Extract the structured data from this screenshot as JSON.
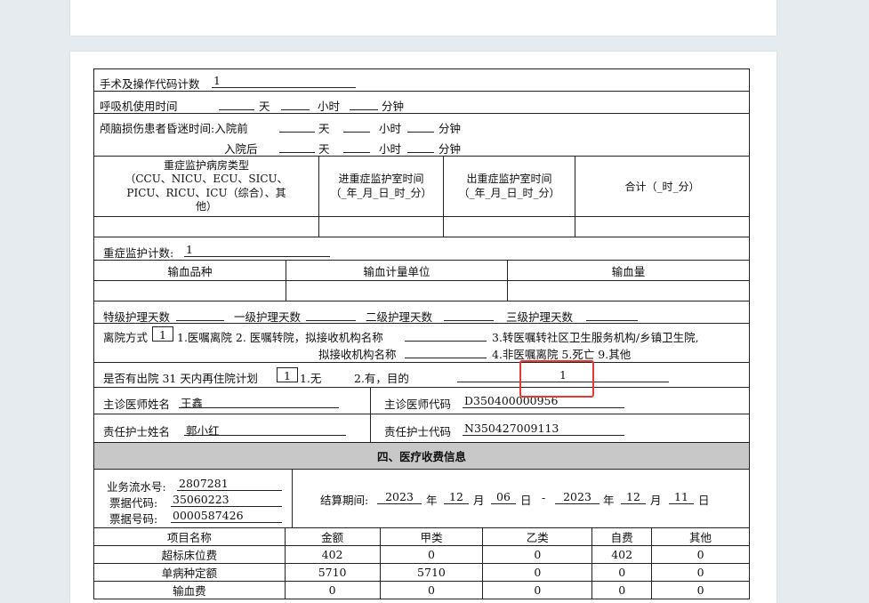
{
  "ops_count": {
    "label": "手术及操作代码计数",
    "value": "1"
  },
  "ventilator": {
    "label": "呼吸机使用时间",
    "day": "天",
    "hour": "小时",
    "minute": "分钟"
  },
  "coma": {
    "label": "颅脑损伤患者昏迷时间:入院前",
    "after_label": "入院后",
    "day": "天",
    "hour": "小时",
    "minute": "分钟"
  },
  "icu_table": {
    "col1": "重症监护病房类型\n（CCU、NICU、ECU、SICU、\nPICU、RICU、ICU（综合）、其\n他）",
    "col2": "进重症监护室时间\n（_年_月_日_时_分）",
    "col3": "出重症监护室时间\n（_年_月_日_时_分）",
    "col4": "合计（_时_分）"
  },
  "icu_count": {
    "label": "重症监护计数:",
    "value": "1"
  },
  "transfusion": {
    "col1": "输血品种",
    "col2": "输血计量单位",
    "col3": "输血量"
  },
  "nursing": {
    "special": "特级护理天数",
    "level1": "一级护理天数",
    "level2": "二级护理天数",
    "level3": "三级护理天数"
  },
  "discharge": {
    "label": "离院方式",
    "value": "1",
    "opt1": "1.医嘱离院 2. 医嘱转院，拟接收机构名称",
    "opt3": "3.转医嘱转社区卫生服务机构/乡镇卫生院,",
    "line2_label": "拟接收机构名称",
    "opt4": "4.非医嘱离院 5.死亡 9.其他"
  },
  "readmit": {
    "label": "是否有出院 31 天内再住院计划",
    "value": "1",
    "opt1": "1.无",
    "opt2": "2.有，目的",
    "purpose": "1"
  },
  "doctor": {
    "name_label": "主诊医师姓名",
    "name": "王鑫",
    "code_label": "主诊医师代码",
    "code": "D350400000956"
  },
  "nurse": {
    "name_label": "责任护士姓名",
    "name": "郭小红",
    "code_label": "责任护士代码",
    "code": "N350427009113"
  },
  "section4": {
    "title": "四、医疗收费信息"
  },
  "billing": {
    "serial_label": "业务流水号:",
    "serial": "2807281",
    "code_label": "票据代码:",
    "code": "35060223",
    "number_label": "票据号码:",
    "number": "0000587426",
    "period_label": "结算期间:",
    "start_year": "2023",
    "start_month": "12",
    "start_day": "06",
    "end_year": "2023",
    "end_month": "12",
    "end_day": "11",
    "year": "年",
    "month": "月",
    "day": "日",
    "dash": "-"
  },
  "fees": {
    "headers": [
      "项目名称",
      "金额",
      "甲类",
      "乙类",
      "自费",
      "其他"
    ],
    "rows": [
      [
        "超标床位费",
        "402",
        "0",
        "0",
        "402",
        "0"
      ],
      [
        "单病种定额",
        "5710",
        "5710",
        "0",
        "0",
        "0"
      ],
      [
        "输血费",
        "0",
        "0",
        "0",
        "0",
        "0"
      ]
    ]
  }
}
